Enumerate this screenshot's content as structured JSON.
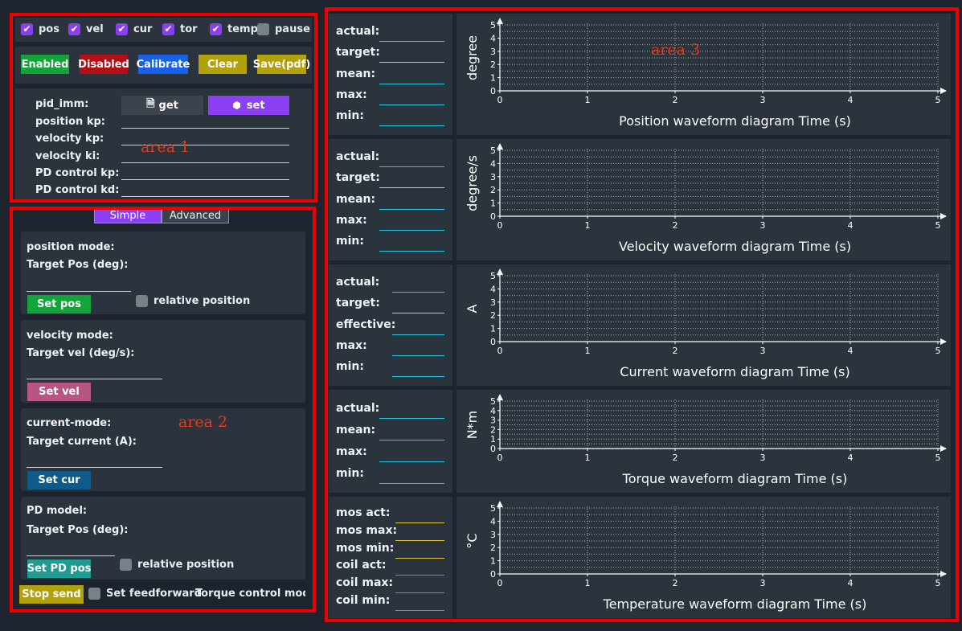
{
  "checkboxes": [
    {
      "label": "pos",
      "checked": true
    },
    {
      "label": "vel",
      "checked": true
    },
    {
      "label": "cur",
      "checked": true
    },
    {
      "label": "tor",
      "checked": true
    },
    {
      "label": "temp",
      "checked": true
    },
    {
      "label": "pause",
      "checked": false
    }
  ],
  "buttons": {
    "enabled": "Enabled",
    "disabled": "Disabled",
    "calibrate": "Calibrate",
    "clear": "Clear",
    "save": "Save(pdf)"
  },
  "pid": {
    "title": "pid_imm:",
    "get": "get",
    "set": "set",
    "fields": [
      "position kp:",
      "velocity kp:",
      "velocity ki:",
      "PD control kp:",
      "PD control kd:"
    ]
  },
  "area_labels": {
    "a1": "area 1",
    "a2": "area 2",
    "a3": "area 3"
  },
  "tabs": {
    "simple": "Simple",
    "advanced": "Advanced"
  },
  "modes": {
    "position": {
      "title": "position mode:",
      "label": "Target Pos (deg):",
      "button": "Set pos",
      "relative": "relative position"
    },
    "velocity": {
      "title": "velocity mode:",
      "label": "Target vel (deg/s):",
      "button": "Set vel"
    },
    "current": {
      "title": "current-mode:",
      "label": "Target current (A):",
      "button": "Set cur"
    },
    "pd": {
      "title": "PD model:",
      "label": "Target Pos (deg):",
      "button": "Set PD pos",
      "relative": "relative position"
    }
  },
  "bottom": {
    "stop": "Stop send",
    "feedforward": "Set feedforward",
    "torque": "Torque control mode"
  },
  "colors": {
    "cyan": "#27c6dc",
    "green": "#8fe37e",
    "yellow": "#e3c63c",
    "pink": "#e24bd8",
    "accent": "#8b3ff2"
  },
  "charts": [
    {
      "info": [
        {
          "k": "actual:",
          "c": "cyan"
        },
        {
          "k": "target:",
          "c": "green"
        },
        {
          "k": "mean:",
          "c": "cyan"
        },
        {
          "k": "max:",
          "c": "cyan"
        },
        {
          "k": "min:",
          "c": "cyan"
        }
      ],
      "chart_data": {
        "type": "line",
        "ylabel": "degree",
        "xlabel": "Position waveform diagram  Time (s)",
        "xlim": [
          0,
          5
        ],
        "ylim": [
          0,
          5
        ],
        "xticks": [
          0,
          1,
          2,
          3,
          4,
          5
        ],
        "yticks": [
          0,
          1,
          2,
          3,
          4,
          5
        ],
        "series": [],
        "grid": true
      }
    },
    {
      "info": [
        {
          "k": "actual:",
          "c": "cyan"
        },
        {
          "k": "target:",
          "c": "green"
        },
        {
          "k": "mean:",
          "c": "cyan"
        },
        {
          "k": "max:",
          "c": "cyan"
        },
        {
          "k": "min:",
          "c": "cyan"
        }
      ],
      "chart_data": {
        "type": "line",
        "ylabel": "degree/s",
        "xlabel": "Velocity waveform diagram  Time (s)",
        "xlim": [
          0,
          5
        ],
        "ylim": [
          0,
          5
        ],
        "xticks": [
          0,
          1,
          2,
          3,
          4,
          5
        ],
        "yticks": [
          0,
          1,
          2,
          3,
          4,
          5
        ],
        "series": [],
        "grid": true
      }
    },
    {
      "info": [
        {
          "k": "actual:",
          "c": "cyan"
        },
        {
          "k": "target:",
          "c": "green"
        },
        {
          "k": "effective:",
          "c": "cyan"
        },
        {
          "k": "max:",
          "c": "cyan"
        },
        {
          "k": "min:",
          "c": "cyan"
        }
      ],
      "chart_data": {
        "type": "line",
        "ylabel": "A",
        "xlabel": "Current waveform diagram  Time (s)",
        "xlim": [
          0,
          5
        ],
        "ylim": [
          0,
          5
        ],
        "xticks": [
          0,
          1,
          2,
          3,
          4,
          5
        ],
        "yticks": [
          0,
          1,
          2,
          3,
          4,
          5
        ],
        "series": [],
        "grid": true
      }
    },
    {
      "info": [
        {
          "k": "actual:",
          "c": "cyan"
        },
        {
          "k": "mean:",
          "c": "cyan"
        },
        {
          "k": "max:",
          "c": "cyan"
        },
        {
          "k": "min:",
          "c": "cyan"
        }
      ],
      "chart_data": {
        "type": "line",
        "ylabel": "N*m",
        "xlabel": "Torque waveform diagram  Time (s)",
        "xlim": [
          0,
          5
        ],
        "ylim": [
          0,
          5
        ],
        "xticks": [
          0,
          1,
          2,
          3,
          4,
          5
        ],
        "yticks": [
          0,
          1,
          2,
          3,
          4,
          5
        ],
        "series": [],
        "grid": true
      }
    },
    {
      "info": [
        {
          "k": "mos act:",
          "c": "yellow"
        },
        {
          "k": "mos max:",
          "c": "yellow"
        },
        {
          "k": "mos min:",
          "c": "yellow"
        },
        {
          "k": "coil act:",
          "c": "pink"
        },
        {
          "k": "coil max:",
          "c": "pink"
        },
        {
          "k": "coil min:",
          "c": "pink"
        }
      ],
      "chart_data": {
        "type": "line",
        "ylabel": "°C",
        "xlabel": "Temperature waveform diagram  Time (s)",
        "xlim": [
          0,
          5
        ],
        "ylim": [
          0,
          5
        ],
        "xticks": [
          0,
          1,
          2,
          3,
          4,
          5
        ],
        "yticks": [
          0,
          1,
          2,
          3,
          4,
          5
        ],
        "series": [],
        "grid": true
      }
    }
  ]
}
